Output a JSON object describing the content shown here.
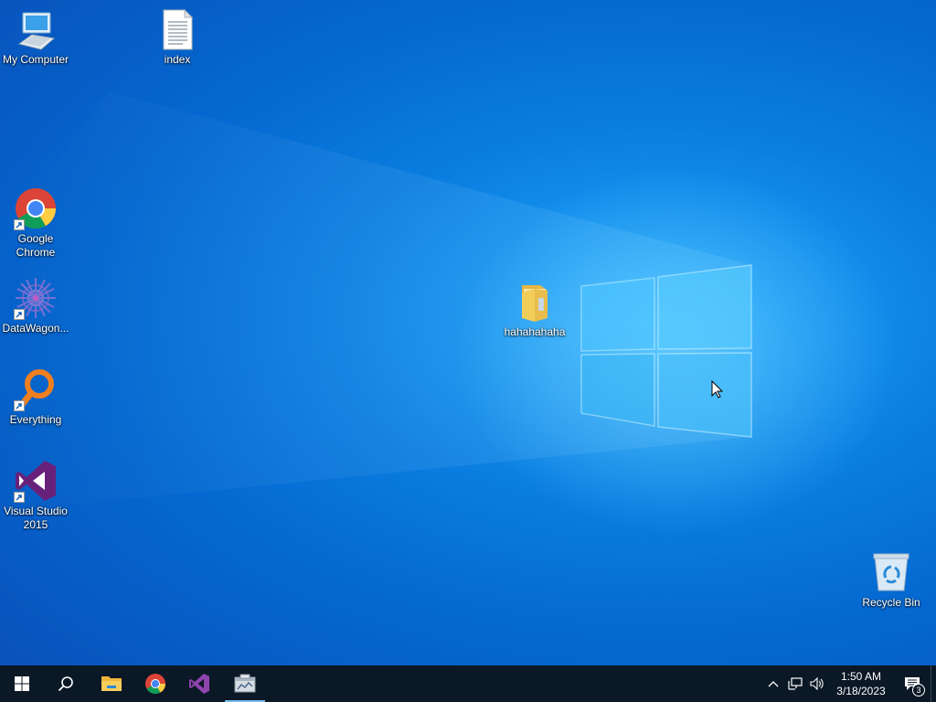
{
  "desktop": {
    "icons": [
      {
        "label": "My Computer",
        "icon": "computer-icon"
      },
      {
        "label": "index",
        "icon": "text-file-icon"
      },
      {
        "label": "Google Chrome",
        "icon": "chrome-icon"
      },
      {
        "label": "DataWagon...",
        "icon": "datawagon-icon"
      },
      {
        "label": "Everything",
        "icon": "everything-search-icon"
      },
      {
        "label": "Visual Studio 2015",
        "icon": "visual-studio-icon"
      },
      {
        "label": "hahahahaha",
        "icon": "folder-icon"
      },
      {
        "label": "Recycle Bin",
        "icon": "recycle-bin-icon"
      }
    ]
  },
  "taskbar": {
    "pinned": [
      "start-icon",
      "search-icon",
      "file-explorer-icon",
      "chrome-icon",
      "visual-studio-icon",
      "app-window-icon"
    ],
    "clock": {
      "time": "1:50 AM",
      "date": "3/18/2023"
    },
    "notification_count": "3"
  },
  "colors": {
    "taskbar": "#0b1826",
    "accent": "#76b9ed"
  }
}
